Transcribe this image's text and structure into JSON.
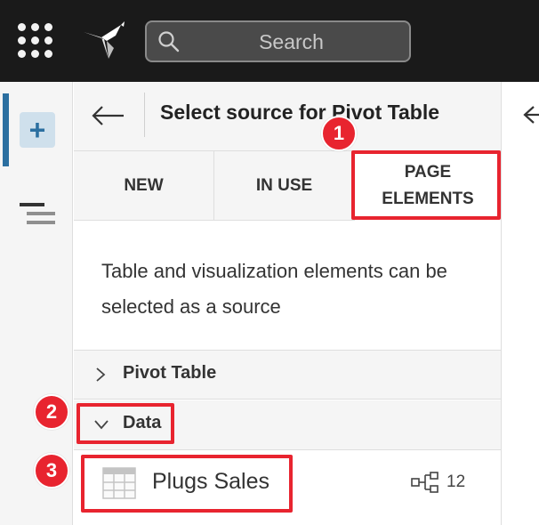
{
  "topbar": {
    "search_placeholder": "Search"
  },
  "panel": {
    "title": "Select source for Pivot Table",
    "tabs": [
      {
        "label": "NEW"
      },
      {
        "label": "IN USE"
      },
      {
        "label": "PAGE ELEMENTS"
      }
    ],
    "description": "Table and visualization elements can be selected as a source",
    "sections": [
      {
        "label": "Pivot Table",
        "expanded": false
      },
      {
        "label": "Data",
        "expanded": true
      }
    ],
    "item": {
      "label": "Plugs Sales",
      "count": "12"
    }
  },
  "annotations": [
    {
      "number": "1"
    },
    {
      "number": "2"
    },
    {
      "number": "3"
    }
  ],
  "colors": {
    "accent": "#2b6fa0",
    "annotation": "#e8242f",
    "topbar": "#1a1a1a"
  }
}
